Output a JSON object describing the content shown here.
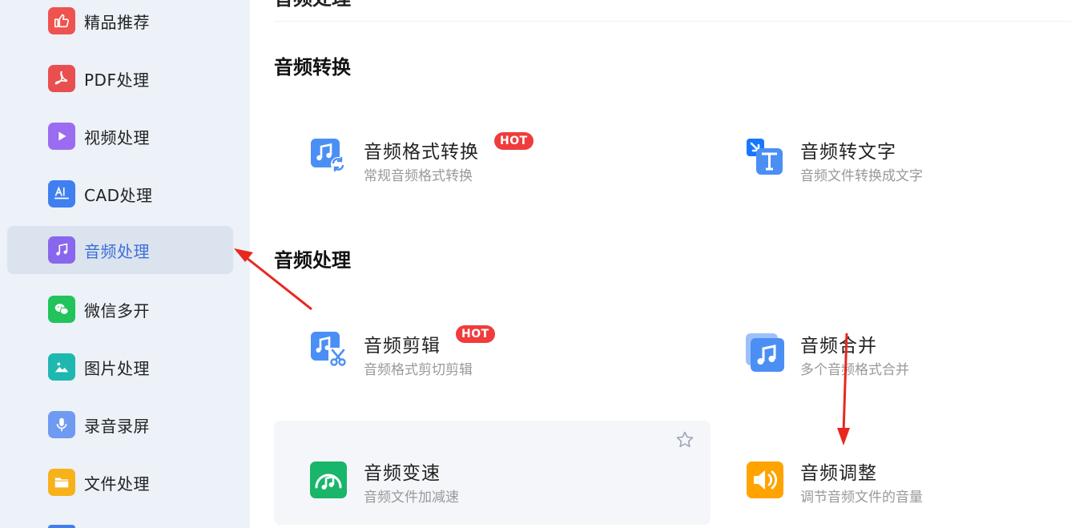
{
  "sidebar": {
    "items": [
      {
        "label": "精品推荐",
        "icon": "thumbs-up-icon",
        "color": "#ef5350"
      },
      {
        "label": "PDF处理",
        "icon": "pdf-icon",
        "color": "#e94f4f"
      },
      {
        "label": "视频处理",
        "icon": "play-icon",
        "color": "#9b6cf0"
      },
      {
        "label": "CAD处理",
        "icon": "cad-icon",
        "color": "#3f7ff0"
      },
      {
        "label": "音频处理",
        "icon": "music-note-icon",
        "color": "#8866ee",
        "active": true
      },
      {
        "label": "微信多开",
        "icon": "wechat-icon",
        "color": "#21c35a"
      },
      {
        "label": "图片处理",
        "icon": "image-icon",
        "color": "#1fb8b0"
      },
      {
        "label": "录音录屏",
        "icon": "microphone-icon",
        "color": "#6f9af2"
      },
      {
        "label": "文件处理",
        "icon": "folder-icon",
        "color": "#f7b21b"
      }
    ]
  },
  "main": {
    "top_title": "音频处理",
    "sections": [
      {
        "title": "音频转换"
      },
      {
        "title": "音频处理"
      }
    ],
    "tools": {
      "format_convert": {
        "title": "音频格式转换",
        "desc": "常规音频格式转换",
        "badge": "HOT",
        "icon": "music-convert-icon"
      },
      "to_text": {
        "title": "音频转文字",
        "desc": "音频文件转换成文字",
        "icon": "audio-to-text-icon"
      },
      "cut": {
        "title": "音频剪辑",
        "desc": "音频格式剪切剪辑",
        "badge": "HOT",
        "icon": "music-scissors-icon"
      },
      "merge": {
        "title": "音频合并",
        "desc": "多个音频格式合并",
        "icon": "music-merge-icon"
      },
      "speed": {
        "title": "音频变速",
        "desc": "音频文件加减速",
        "icon": "music-speed-icon"
      },
      "volume": {
        "title": "音频调整",
        "desc": "调节音频文件的音量",
        "icon": "speaker-icon"
      }
    }
  },
  "colors": {
    "accent": "#3d6fd9",
    "hot": "#f03c3c",
    "annotation_arrow": "#e8281e"
  }
}
